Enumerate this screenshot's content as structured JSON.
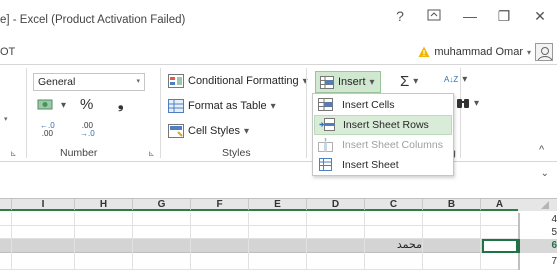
{
  "window": {
    "title": "e] - Excel (Product Activation Failed)",
    "help": "?",
    "ribbon_display": "⊼",
    "minimize": "—",
    "restore": "❐",
    "close": "✕"
  },
  "tabs": {
    "fragment": "OT"
  },
  "account": {
    "user_name": "muhammad Omar",
    "caret": "▾"
  },
  "ribbon": {
    "number": {
      "format_value": "General",
      "percent": "%",
      "comma": "❟",
      "inc_decimal_top": "←.0",
      "inc_decimal_bottom": ".00",
      "dec_decimal_top": ".00",
      "dec_decimal_bottom": "→.0",
      "label": "Number",
      "launcher": "⊾"
    },
    "styles": {
      "conditional": "Conditional Formatting",
      "format_table": "Format as Table",
      "cell_styles": "Cell Styles",
      "label": "Styles",
      "caret": "▾"
    },
    "cells": {
      "insert": "Insert",
      "caret": "▾",
      "label_fragment": "g"
    },
    "editing": {
      "sum": "Σ",
      "sort": "A↓Z",
      "find": "🔍",
      "caret": "▾"
    },
    "left_launcher": "⊾",
    "left_caret": "▾",
    "collapse": "^"
  },
  "insert_menu": {
    "items": [
      {
        "label": "Insert Cells",
        "disabled": false,
        "highlighted": false
      },
      {
        "label": "Insert Sheet Rows",
        "disabled": false,
        "highlighted": true
      },
      {
        "label": "Insert Sheet Columns",
        "disabled": true,
        "highlighted": false
      },
      {
        "label": "Insert Sheet",
        "disabled": false,
        "highlighted": false
      }
    ]
  },
  "strip": {
    "expand": "⌄"
  },
  "grid": {
    "columns": [
      "I",
      "H",
      "G",
      "F",
      "E",
      "D",
      "C",
      "B",
      "A"
    ],
    "rows": [
      "4",
      "5",
      "6",
      "7"
    ],
    "selected_row": "6",
    "cell_c6": "محمد"
  },
  "colors": {
    "accent_green": "#217346",
    "selected_row_gray": "#d4d4d4",
    "insert_button_bg": "#cfe8cf",
    "menu_highlight": "#d8ecd8",
    "warning": "#f2b600"
  }
}
